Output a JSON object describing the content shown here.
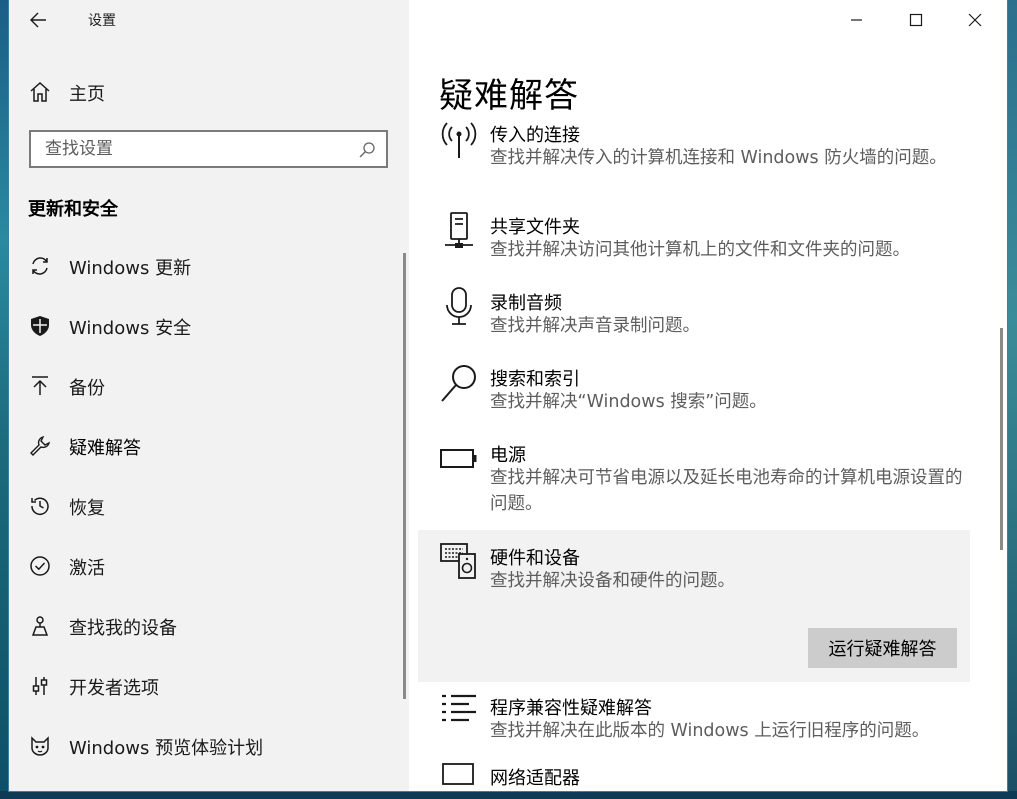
{
  "window": {
    "title": "设置"
  },
  "nav": {
    "home": "主页",
    "search_placeholder": "查找设置",
    "section": "更新和安全",
    "items": [
      {
        "label": "Windows 更新",
        "icon": "refresh-icon"
      },
      {
        "label": "Windows 安全",
        "icon": "shield-icon"
      },
      {
        "label": "备份",
        "icon": "upload-arrow-icon"
      },
      {
        "label": "疑难解答",
        "icon": "wrench-icon",
        "active": true
      },
      {
        "label": "恢复",
        "icon": "history-icon"
      },
      {
        "label": "激活",
        "icon": "check-circle-icon"
      },
      {
        "label": "查找我的设备",
        "icon": "person-pin-icon"
      },
      {
        "label": "开发者选项",
        "icon": "sliders-icon"
      },
      {
        "label": "Windows 预览体验计划",
        "icon": "cat-face-icon"
      }
    ]
  },
  "main": {
    "title": "疑难解答",
    "items": [
      {
        "title": "传入的连接",
        "desc": "查找并解决传入的计算机连接和 Windows 防火墙的问题。",
        "icon": "antenna-icon"
      },
      {
        "title": "共享文件夹",
        "desc": "查找并解决访问其他计算机上的文件和文件夹的问题。",
        "icon": "network-folder-icon"
      },
      {
        "title": "录制音频",
        "desc": "查找并解决声音录制问题。",
        "icon": "microphone-icon"
      },
      {
        "title": "搜索和索引",
        "desc": "查找并解决“Windows 搜索”问题。",
        "icon": "magnifier-icon"
      },
      {
        "title": "电源",
        "desc": "查找并解决可节省电源以及延长电池寿命的计算机电源设置的问题。",
        "icon": "battery-icon"
      },
      {
        "title": "硬件和设备",
        "desc": "查找并解决设备和硬件的问题。",
        "icon": "hardware-icon",
        "selected": true
      },
      {
        "title": "程序兼容性疑难解答",
        "desc": "查找并解决在此版本的 Windows 上运行旧程序的问题。",
        "icon": "list-icon"
      },
      {
        "title": "网络适配器",
        "desc": "",
        "icon": "network-adapter-icon"
      }
    ],
    "run_button": "运行疑难解答"
  }
}
